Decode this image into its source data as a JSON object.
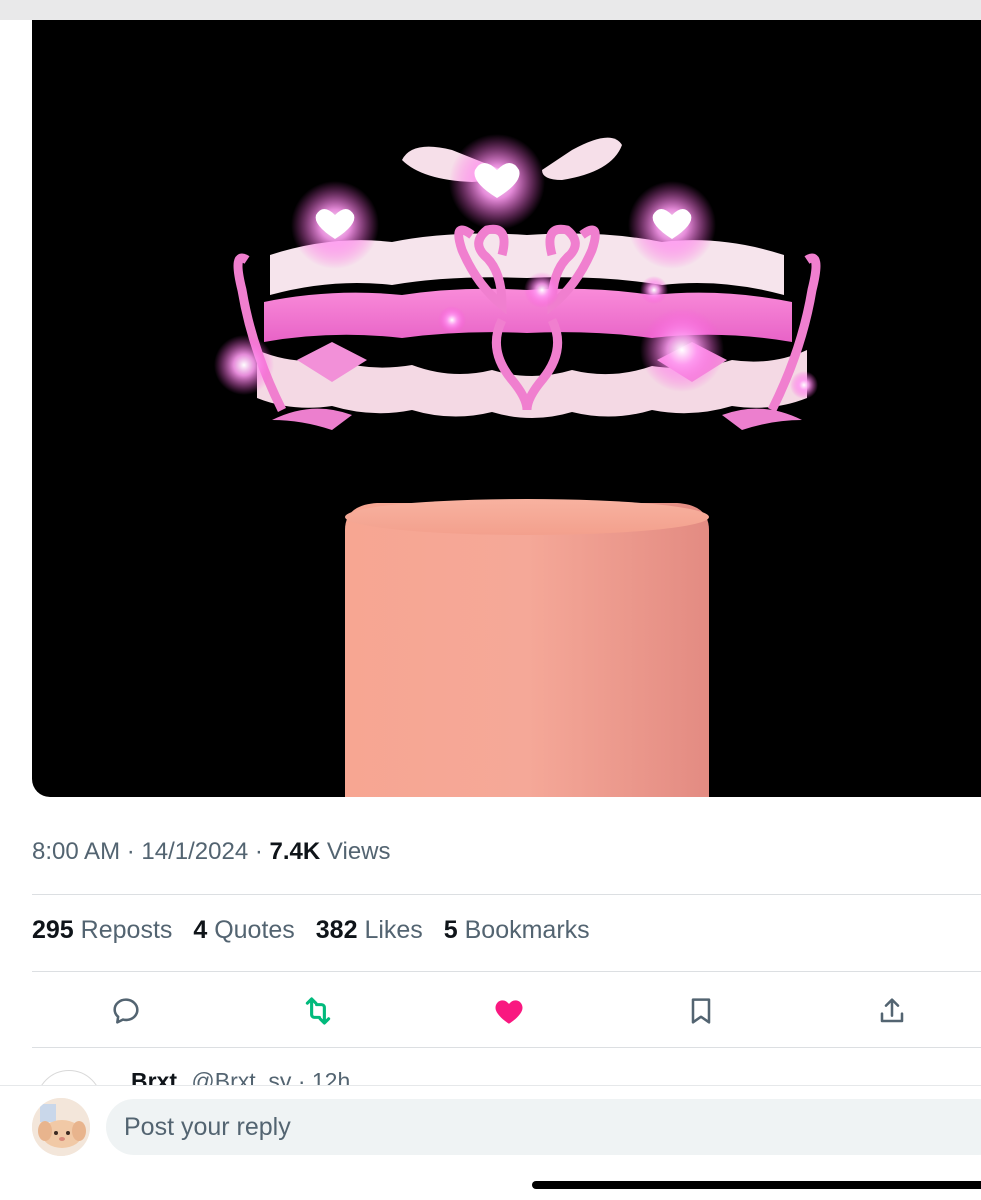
{
  "post": {
    "time": "8:00 AM",
    "date": "14/1/2024",
    "views_count": "7.4K",
    "views_label": "Views"
  },
  "stats": {
    "reposts": {
      "count": "295",
      "label": "Reposts"
    },
    "quotes": {
      "count": "4",
      "label": "Quotes"
    },
    "likes": {
      "count": "382",
      "label": "Likes"
    },
    "bookmarks": {
      "count": "5",
      "label": "Bookmarks"
    }
  },
  "actions": [
    {
      "icon": "reply-icon",
      "color": "#536471"
    },
    {
      "icon": "repost-icon",
      "color": "#00ba7c"
    },
    {
      "icon": "like-icon",
      "color": "#f91880"
    },
    {
      "icon": "bookmark-icon",
      "color": "#536471"
    },
    {
      "icon": "share-icon",
      "color": "#536471"
    }
  ],
  "reply_preview": {
    "name": "Brxt",
    "handle": "@Brxt_sy · 12h"
  },
  "composer": {
    "placeholder": "Post your reply"
  },
  "colors": {
    "accent_like": "#f91880",
    "accent_repost": "#00ba7c",
    "text_secondary": "#536471",
    "text_primary": "#0f1419"
  }
}
